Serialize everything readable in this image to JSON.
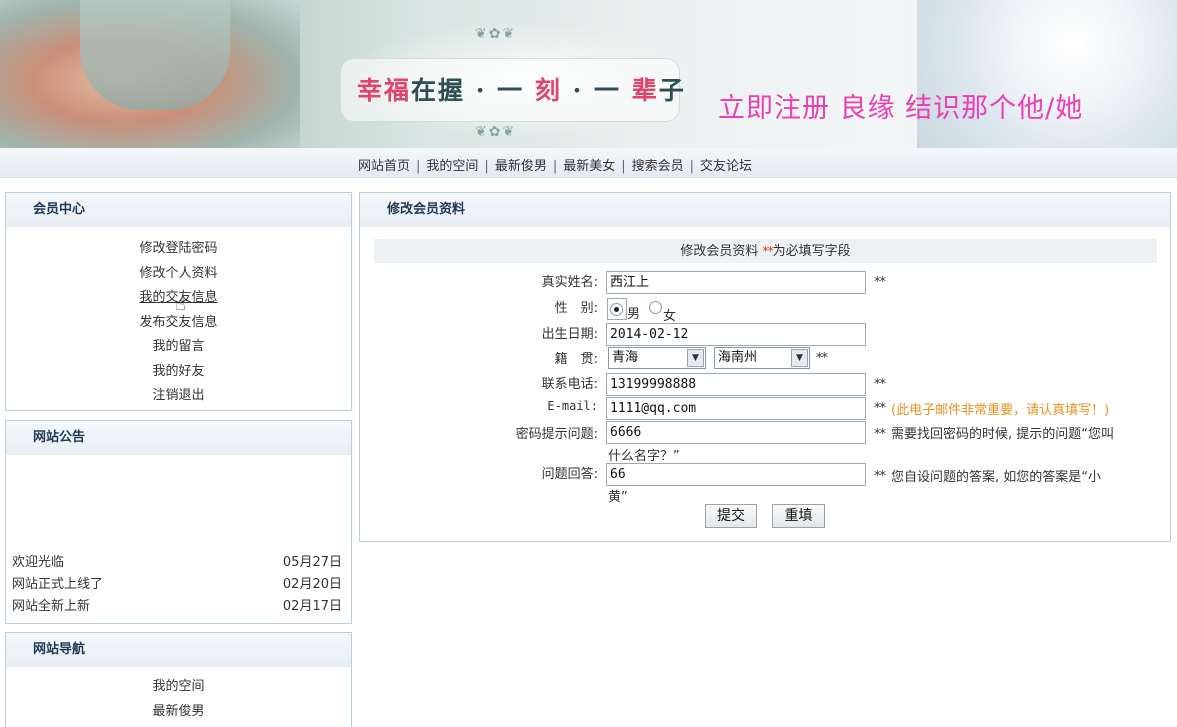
{
  "banner": {
    "slogan_part1": "幸福",
    "slogan_part2": "在握 · 一 ",
    "slogan_part3": "刻",
    "slogan_part4": " · 一 ",
    "slogan_part5": "辈",
    "slogan_part6": "子",
    "register_text": "立即注册 良缘 结识那个他/她"
  },
  "nav": {
    "items": [
      "网站首页",
      "我的空间",
      "最新俊男",
      "最新美女",
      "搜索会员",
      "交友论坛"
    ],
    "separator": "|"
  },
  "member_center": {
    "title": "会员中心",
    "items": [
      "修改登陆密码",
      "修改个人资料",
      "我的交友信息",
      "发布交友信息",
      "我的留言",
      "我的好友",
      "注销退出"
    ]
  },
  "announcements": {
    "title": "网站公告",
    "items": [
      {
        "text": "欢迎光临",
        "date": "05月27日"
      },
      {
        "text": "网站正式上线了",
        "date": "02月20日"
      },
      {
        "text": "网站全新上新",
        "date": "02月17日"
      }
    ]
  },
  "site_nav": {
    "title": "网站导航",
    "items": [
      "我的空间",
      "最新俊男"
    ]
  },
  "form": {
    "header": "修改会员资料",
    "title_prefix": "修改会员资料 ",
    "title_req": "**",
    "title_suffix": "为必填写字段",
    "req_mark": "**",
    "labels": {
      "name": "真实姓名:",
      "gender": "性　别:",
      "birth": "出生日期:",
      "native": "籍　贯:",
      "phone": "联系电话:",
      "email": "E-mail:",
      "question": "密码提示问题:",
      "answer": "问题回答:"
    },
    "values": {
      "name": "西江上",
      "birth": "2014-02-12",
      "province": "青海",
      "city": "海南州",
      "phone": "13199998888",
      "email": "1111@qq.com",
      "question": "6666",
      "answer": "66"
    },
    "gender_options": {
      "male": "男",
      "female": "女",
      "selected": "male"
    },
    "email_note": "(此电子邮件非常重要，请认真填写！)",
    "question_note_1": "需要找回密码的时候, 提示的问题“您叫",
    "question_note_2": "什么名字？”",
    "answer_note_1": "您自设问题的答案, 如您的答案是“小",
    "answer_note_2": "黄”",
    "submit": "提交",
    "reset": "重填"
  },
  "colors": {
    "border": "#b9cfe0",
    "required": "#d92d2d",
    "email_note": "#e8901f",
    "register": "#ec3fb3"
  }
}
